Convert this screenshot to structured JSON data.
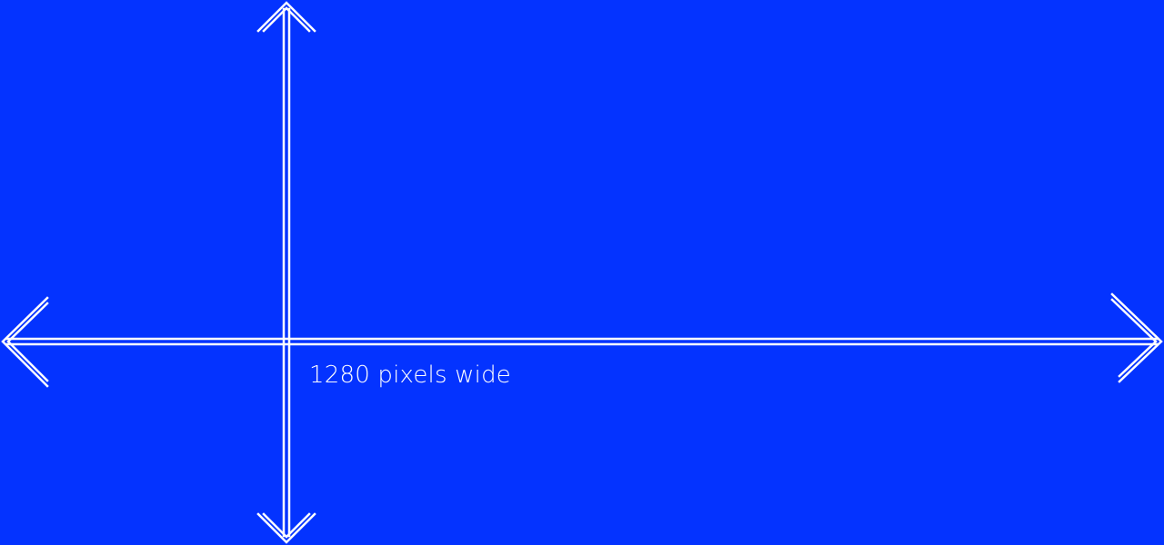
{
  "background_color": "#0433FF",
  "foreground_color": "#FFFFFF",
  "width_label": "1280 pixels wide"
}
